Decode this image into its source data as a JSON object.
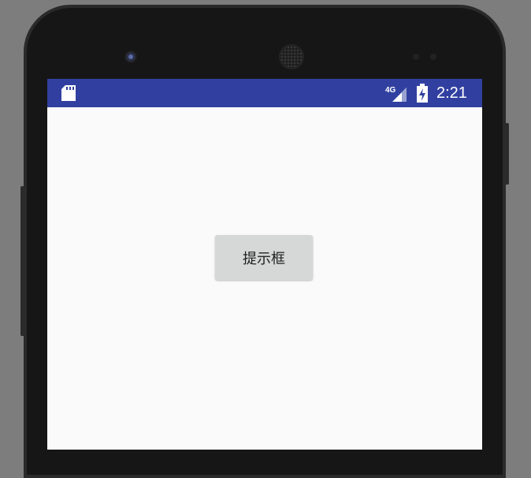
{
  "status_bar": {
    "time": "2:21",
    "network_label": "4G",
    "icons": [
      "sd-card-icon",
      "signal-icon",
      "battery-charging-icon"
    ]
  },
  "main": {
    "button_label": "提示框"
  },
  "colors": {
    "status_bar": "#3140a0",
    "screen_bg": "#fafafa",
    "button_bg": "#d6d7d7"
  }
}
